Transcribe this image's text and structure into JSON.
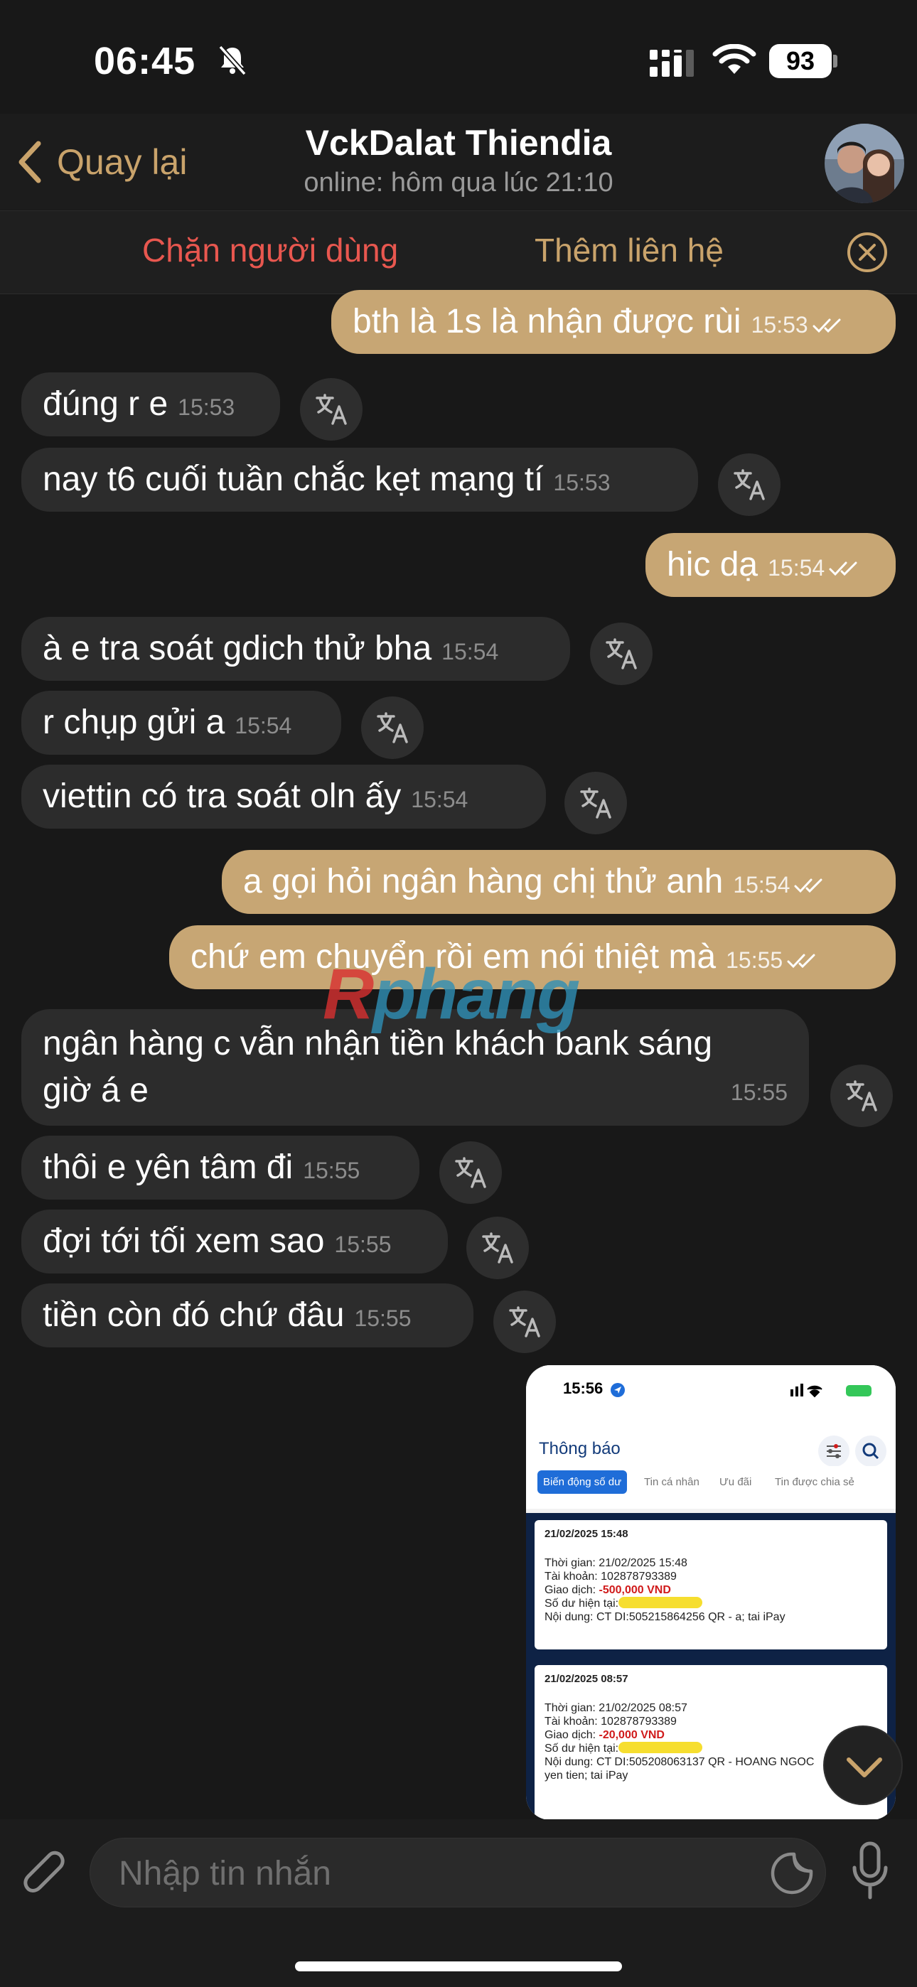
{
  "status_bar": {
    "time": "06:45",
    "battery": "93"
  },
  "header": {
    "back_label": "Quay lại",
    "contact_name": "VckDalat Thiendia",
    "contact_status": "online: hôm qua lúc 21:10"
  },
  "action_bar": {
    "block_label": "Chặn người dùng",
    "add_contact_label": "Thêm liên hệ"
  },
  "messages": [
    {
      "dir": "out",
      "text": "bth là 1s là nhận được rùi",
      "time": "15:53"
    },
    {
      "dir": "in",
      "text": "đúng r e",
      "time": "15:53"
    },
    {
      "dir": "in",
      "text": "nay t6 cuối tuần chắc kẹt mạng tí",
      "time": "15:53"
    },
    {
      "dir": "out",
      "text": "hic dạ",
      "time": "15:54"
    },
    {
      "dir": "in",
      "text": "à e tra soát gdich thử bha",
      "time": "15:54"
    },
    {
      "dir": "in",
      "text": "r chụp gửi a",
      "time": "15:54"
    },
    {
      "dir": "in",
      "text": "viettin có tra soát oln ấy",
      "time": "15:54"
    },
    {
      "dir": "out",
      "text": "a gọi hỏi ngân hàng chị thử anh",
      "time": "15:54"
    },
    {
      "dir": "out",
      "text": "chứ em chuyển rồi em nói thiệt mà",
      "time": "15:55"
    },
    {
      "dir": "in",
      "text_line1": "ngân hàng c vẫn nhận tiền khách bank sáng",
      "text_line2": "giờ á e",
      "time": "15:55"
    },
    {
      "dir": "in",
      "text": "thôi e yên tâm đi",
      "time": "15:55"
    },
    {
      "dir": "in",
      "text": "đợi tới tối xem sao",
      "time": "15:55"
    },
    {
      "dir": "in",
      "text": "tiền còn đó chứ đâu",
      "time": "15:55"
    }
  ],
  "photo": {
    "time": "15:56",
    "title": "Thông báo",
    "tabs": [
      "Biến động số dư",
      "Tin cá nhân",
      "Ưu đãi",
      "Tin được chia sẻ"
    ],
    "cards": [
      {
        "header": "21/02/2025 15:48",
        "line_time": "Thời gian: 21/02/2025 15:48",
        "line_account": "Tài khoản: 102878793389",
        "line_tx_label": "Giao dịch: ",
        "line_tx_value": "-500,000 VND",
        "line_balance": "Số dư hiện tại:",
        "line_content": "Nội dung: CT DI:505215864256 QR - a; tai iPay"
      },
      {
        "header": "21/02/2025 08:57",
        "line_time": "Thời gian: 21/02/2025 08:57",
        "line_account": "Tài khoản: 102878793389",
        "line_tx_label": "Giao dịch: ",
        "line_tx_value": "-20,000 VND",
        "line_balance": "Số dư hiện tại:",
        "line_content": "Nội dung: CT DI:505208063137 QR - HOANG NGOC",
        "line_content2": "yen tien; tai iPay"
      }
    ]
  },
  "watermark": {
    "first": "R",
    "rest": "phang"
  },
  "input": {
    "placeholder": "Nhập tin nhắn"
  },
  "colors": {
    "outgoing": "#c7a674",
    "incoming": "#2c2c2c",
    "accent": "#c9a36b",
    "danger": "#e8574f",
    "background": "#181818"
  }
}
